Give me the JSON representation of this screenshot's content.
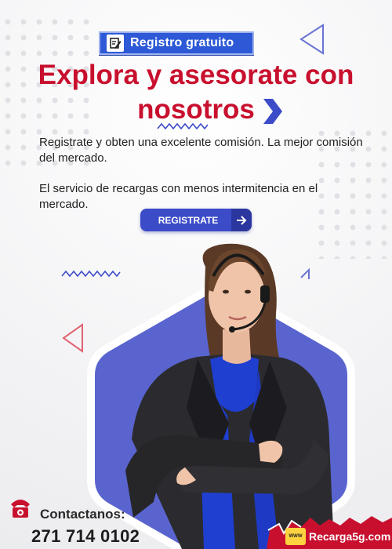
{
  "badge": {
    "label": "Registro gratuito",
    "icon": "edit-note-icon"
  },
  "headline": {
    "line1": "Explora y asesorate con",
    "line2": "nosotros"
  },
  "body": {
    "paragraph1": "Registrate y obten una excelente comisión. La mejor comisión del mercado.",
    "paragraph2": "El servicio de recargas con menos intermitencia en el mercado."
  },
  "cta": {
    "label": "REGISTRATE",
    "icon": "arrow-right-icon"
  },
  "contact": {
    "label": "Contactanos:",
    "phone": "271 714 0102",
    "icon": "telephone-icon"
  },
  "brand": {
    "name": "Recarga5g.com",
    "logo_text": "WWW"
  },
  "colors": {
    "primary_red": "#c8102e",
    "primary_blue": "#3c4bc8",
    "hexagon": "#5560cc",
    "footer": "#c8102e"
  }
}
